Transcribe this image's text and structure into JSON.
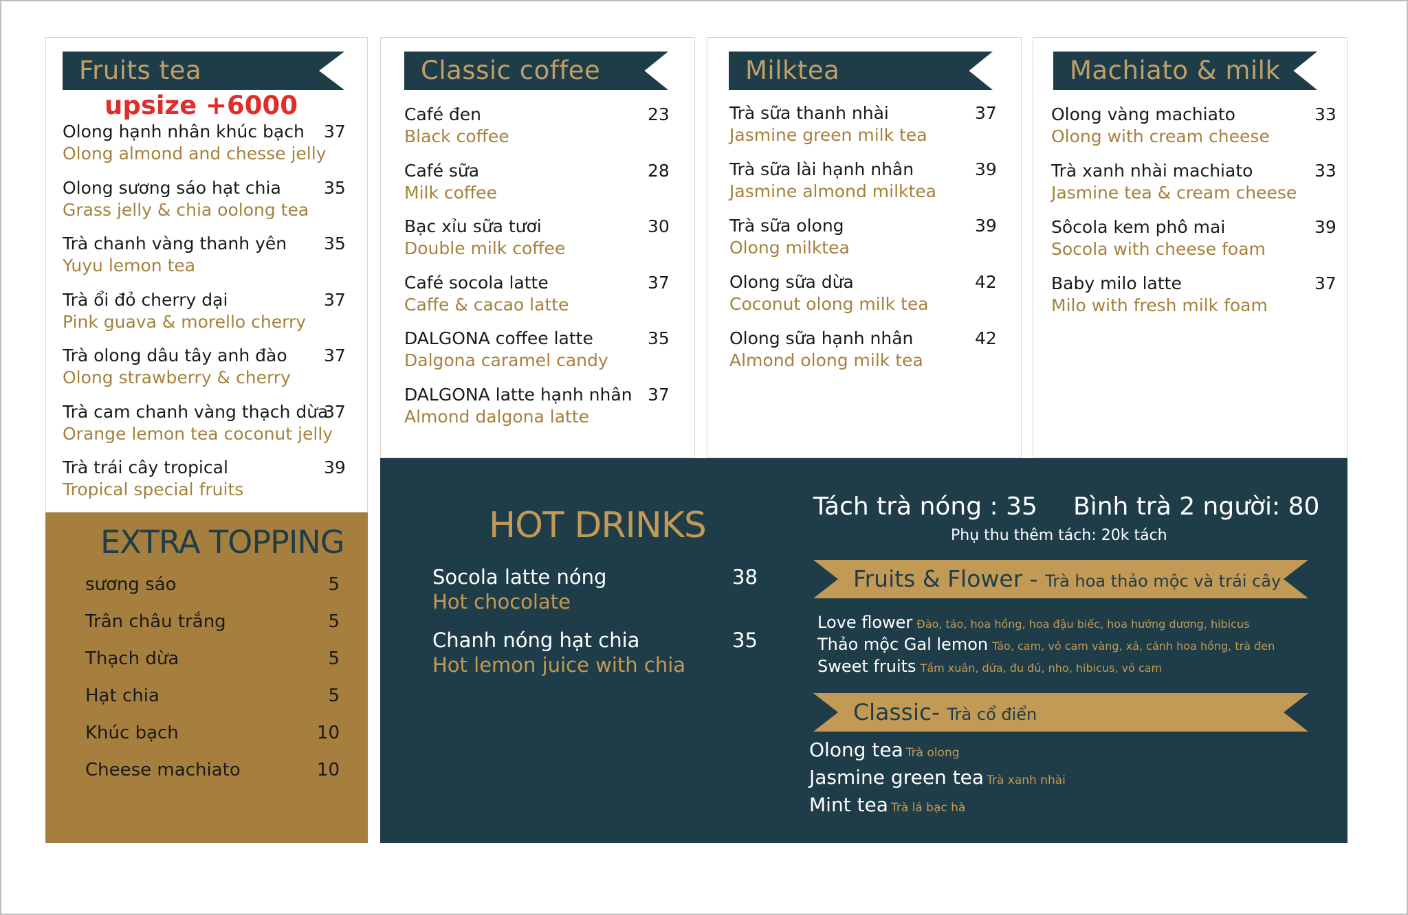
{
  "colors": {
    "navy": "#1f3d48",
    "gold": "#a67f3e",
    "gold_text": "#a5813d",
    "accent_red": "#e12c2c"
  },
  "fruits_tea": {
    "title": "Fruits tea",
    "upsize": "upsize +6000",
    "items": [
      {
        "vn": "Olong hạnh nhân khúc bạch",
        "en": "Olong almond and chesse jelly",
        "price": "37"
      },
      {
        "vn": "Olong sương sáo hạt chia",
        "en": "Grass jelly & chia oolong tea",
        "price": "35"
      },
      {
        "vn": "Trà chanh vàng thanh yên",
        "en": "Yuyu lemon tea",
        "price": "35"
      },
      {
        "vn": "Trà ổi đỏ cherry dại",
        "en": "Pink guava & morello cherry",
        "price": "37"
      },
      {
        "vn": "Trà olong dâu tây anh đào",
        "en": "Olong strawberry & cherry",
        "price": "37"
      },
      {
        "vn": "Trà cam chanh vàng thạch dừa",
        "en": "Orange lemon tea  coconut jelly",
        "price": "37"
      },
      {
        "vn": "Trà trái cây tropical",
        "en": "Tropical special fruits",
        "price": "39"
      }
    ]
  },
  "classic_coffee": {
    "title": "Classic coffee",
    "items": [
      {
        "vn": "Café đen",
        "en": "Black coffee",
        "price": "23"
      },
      {
        "vn": "Café sữa",
        "en": "Milk coffee",
        "price": "28"
      },
      {
        "vn": "Bạc xỉu sữa tươi",
        "en": "Double milk coffee",
        "price": "30"
      },
      {
        "vn": "Café socola latte",
        "en": "Caffe & cacao latte",
        "price": "37"
      },
      {
        "vn": "DALGONA coffee latte",
        "en": "Dalgona caramel candy",
        "price": "35"
      },
      {
        "vn": "DALGONA latte hạnh nhân",
        "en": "Almond dalgona latte",
        "price": "37"
      }
    ]
  },
  "milktea": {
    "title": "Milktea",
    "items": [
      {
        "vn": "Trà sữa thanh nhài",
        "en": "Jasmine green milk tea",
        "price": "37"
      },
      {
        "vn": "Trà sữa lài hạnh nhân",
        "en": "Jasmine almond milktea",
        "price": "39"
      },
      {
        "vn": "Trà sữa olong",
        "en": "Olong milktea",
        "price": "39"
      },
      {
        "vn": "Olong sữa dừa",
        "en": "Coconut olong milk tea",
        "price": "42"
      },
      {
        "vn": "Olong sữa hạnh nhân",
        "en": "Almond olong milk tea",
        "price": "42"
      }
    ]
  },
  "machiato": {
    "title": "Machiato & milk",
    "items": [
      {
        "vn": "Olong vàng machiato",
        "en": "Olong with cream cheese",
        "price": "33"
      },
      {
        "vn": "Trà xanh nhài machiato",
        "en": "Jasmine tea & cream cheese",
        "price": "33"
      },
      {
        "vn": "Sôcola kem phô mai",
        "en": "Socola with cheese foam",
        "price": "39"
      },
      {
        "vn": "Baby milo latte",
        "en": "Milo with fresh milk foam",
        "price": "37"
      }
    ]
  },
  "topping": {
    "title": "EXTRA TOPPING",
    "items": [
      {
        "name": "sương sáo",
        "price": "5"
      },
      {
        "name": "Trân châu trắng",
        "price": "5"
      },
      {
        "name": "Thạch dừa",
        "price": "5"
      },
      {
        "name": "Hạt chia",
        "price": "5"
      },
      {
        "name": "Khúc bạch",
        "price": "10"
      },
      {
        "name": "Cheese machiato",
        "price": "10"
      }
    ]
  },
  "hot_drinks": {
    "title": "HOT DRINKS",
    "items": [
      {
        "vn": "Socola latte nóng",
        "en": "Hot chocolate",
        "price": "38"
      },
      {
        "vn": "Chanh nóng hạt chia",
        "en": "Hot lemon juice with chia",
        "price": "35"
      }
    ],
    "tach_tra": "Tách trà nóng  : 35",
    "binh_tra": "Bình trà 2 người: 80",
    "surcharge": "Phụ thu thêm tách: 20k tách",
    "fruits_flower": {
      "title": "Fruits & Flower - ",
      "subtitle": "Trà hoa thảo mộc  và trái cây",
      "lines": [
        {
          "name": "Love flower",
          "desc": "Đào, táo, hoa hồng, hoa đậu biếc, hoa hướng dương, hibicus"
        },
        {
          "name": "Thảo mộc Gal lemon",
          "desc": "Táo, cam, vỏ cam vàng, xả, cánh hoa hồng, trà đen"
        },
        {
          "name": "Sweet fruits",
          "desc": "Tầm xuân, dứa, đu đủ, nho, hibicus, vỏ cam"
        }
      ]
    },
    "classic": {
      "title": "Classic- ",
      "subtitle": "Trà cổ điển",
      "lines": [
        {
          "name": "Olong tea",
          "desc": "Trà olong"
        },
        {
          "name": "Jasmine green tea",
          "desc": "Trà xanh nhài"
        },
        {
          "name": "Mint tea",
          "desc": "Trà lá bạc hà"
        }
      ]
    }
  }
}
